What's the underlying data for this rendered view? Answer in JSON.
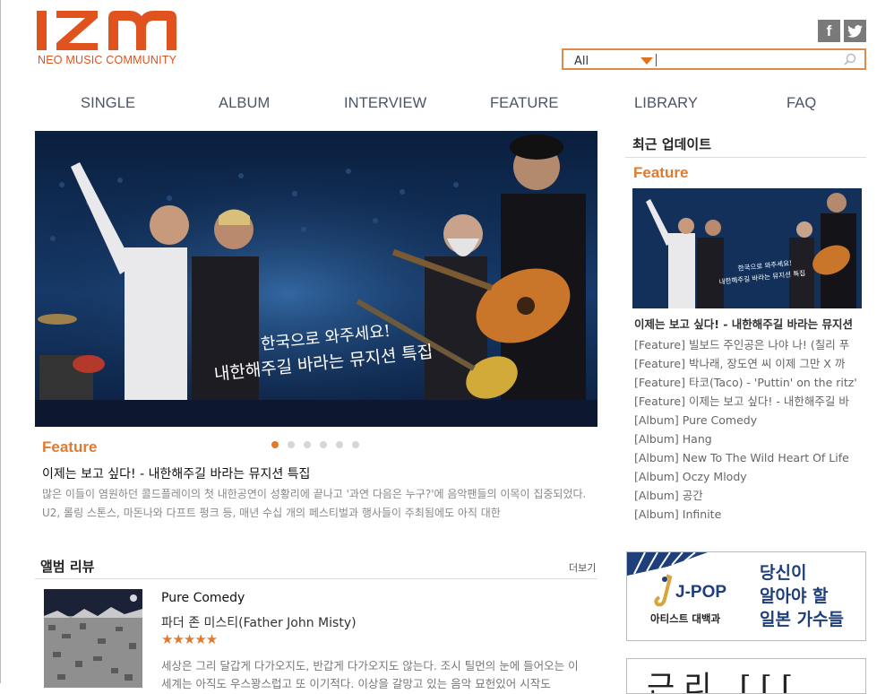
{
  "brand": {
    "logo_text": "IZM",
    "tagline": "NEO MUSIC COMMUNITY",
    "accent_color": "#e0531e"
  },
  "social": {
    "facebook_label": "f",
    "twitter_label": "t",
    "facebook_icon": "facebook-icon",
    "twitter_icon": "twitter-icon"
  },
  "search": {
    "category": "All",
    "placeholder": "",
    "icon": "search-icon"
  },
  "nav": {
    "items": [
      "SINGLE",
      "ALBUM",
      "INTERVIEW",
      "FEATURE",
      "LIBRARY",
      "FAQ"
    ]
  },
  "hero": {
    "caption_line1": "한국으로 와주세요!",
    "caption_line2": "내한해주길 바라는 뮤지션 특집",
    "category": "Feature",
    "slides_total": 6,
    "active_slide": 1,
    "title": "이제는 보고 싶다! - 내한해주길 바라는 뮤지션 특집",
    "description": "많은 이들이 염원하던 콜드플레이의 첫 내한공연이 성황리에 끝나고 '과연 다음은 누구?'에 음악팬들의 이목이 집중되었다. U2, 롤링 스톤스, 마돈나와 다프트 펑크 등, 매년 수십 개의 페스티벌과 행사들이 주최됨에도 아직 대한"
  },
  "recent": {
    "title": "최근 업데이트",
    "category": "Feature",
    "thumb_caption_line1": "한국으로 와주세요!",
    "thumb_caption_line2": "내한해주길 바라는 뮤지션 특집",
    "headline": "이제는 보고 싶다! - 내한해주길 바라는 뮤지션",
    "items": [
      "[Feature] 빌보드 주인공은 나야 나! (칠리 푸",
      "[Feature] 박나래, 장도연 씨 이제 그만 X 까",
      "[Feature] 타코(Taco) - 'Puttin' on the ritz'",
      "[Feature] 이제는 보고 싶다! - 내한해주길 바",
      "[Album] Pure Comedy",
      "[Album] Hang",
      "[Album] New To The Wild Heart Of Life",
      "[Album] Oczy Mlody",
      "[Album] 공간",
      "[Album] Infinite"
    ]
  },
  "review": {
    "section_title": "앨범 리뷰",
    "more_label": "더보기",
    "album": "Pure Comedy",
    "artist": "파더 존 미스티(Father John Misty)",
    "rating": 4.5,
    "stars_text": "★★★★★",
    "excerpt": "세상은 그리 달갑게 다가오지도, 반갑게 다가오지도 않는다. 조시 틸먼의 눈에 들어오는 이 세계는 아직도 우스꽝스럽고 또 이기적다. 이상을 갈망고 있는 음악 묘헌있어 시작도"
  },
  "banner1": {
    "jpop": "J-POP",
    "subtitle": "아티스트 대백과",
    "line1": "당신이",
    "line2": "알아야 할",
    "line3": "일본 가수들"
  },
  "banner2": {
    "text": "근리 ⌈⌈⌈"
  }
}
